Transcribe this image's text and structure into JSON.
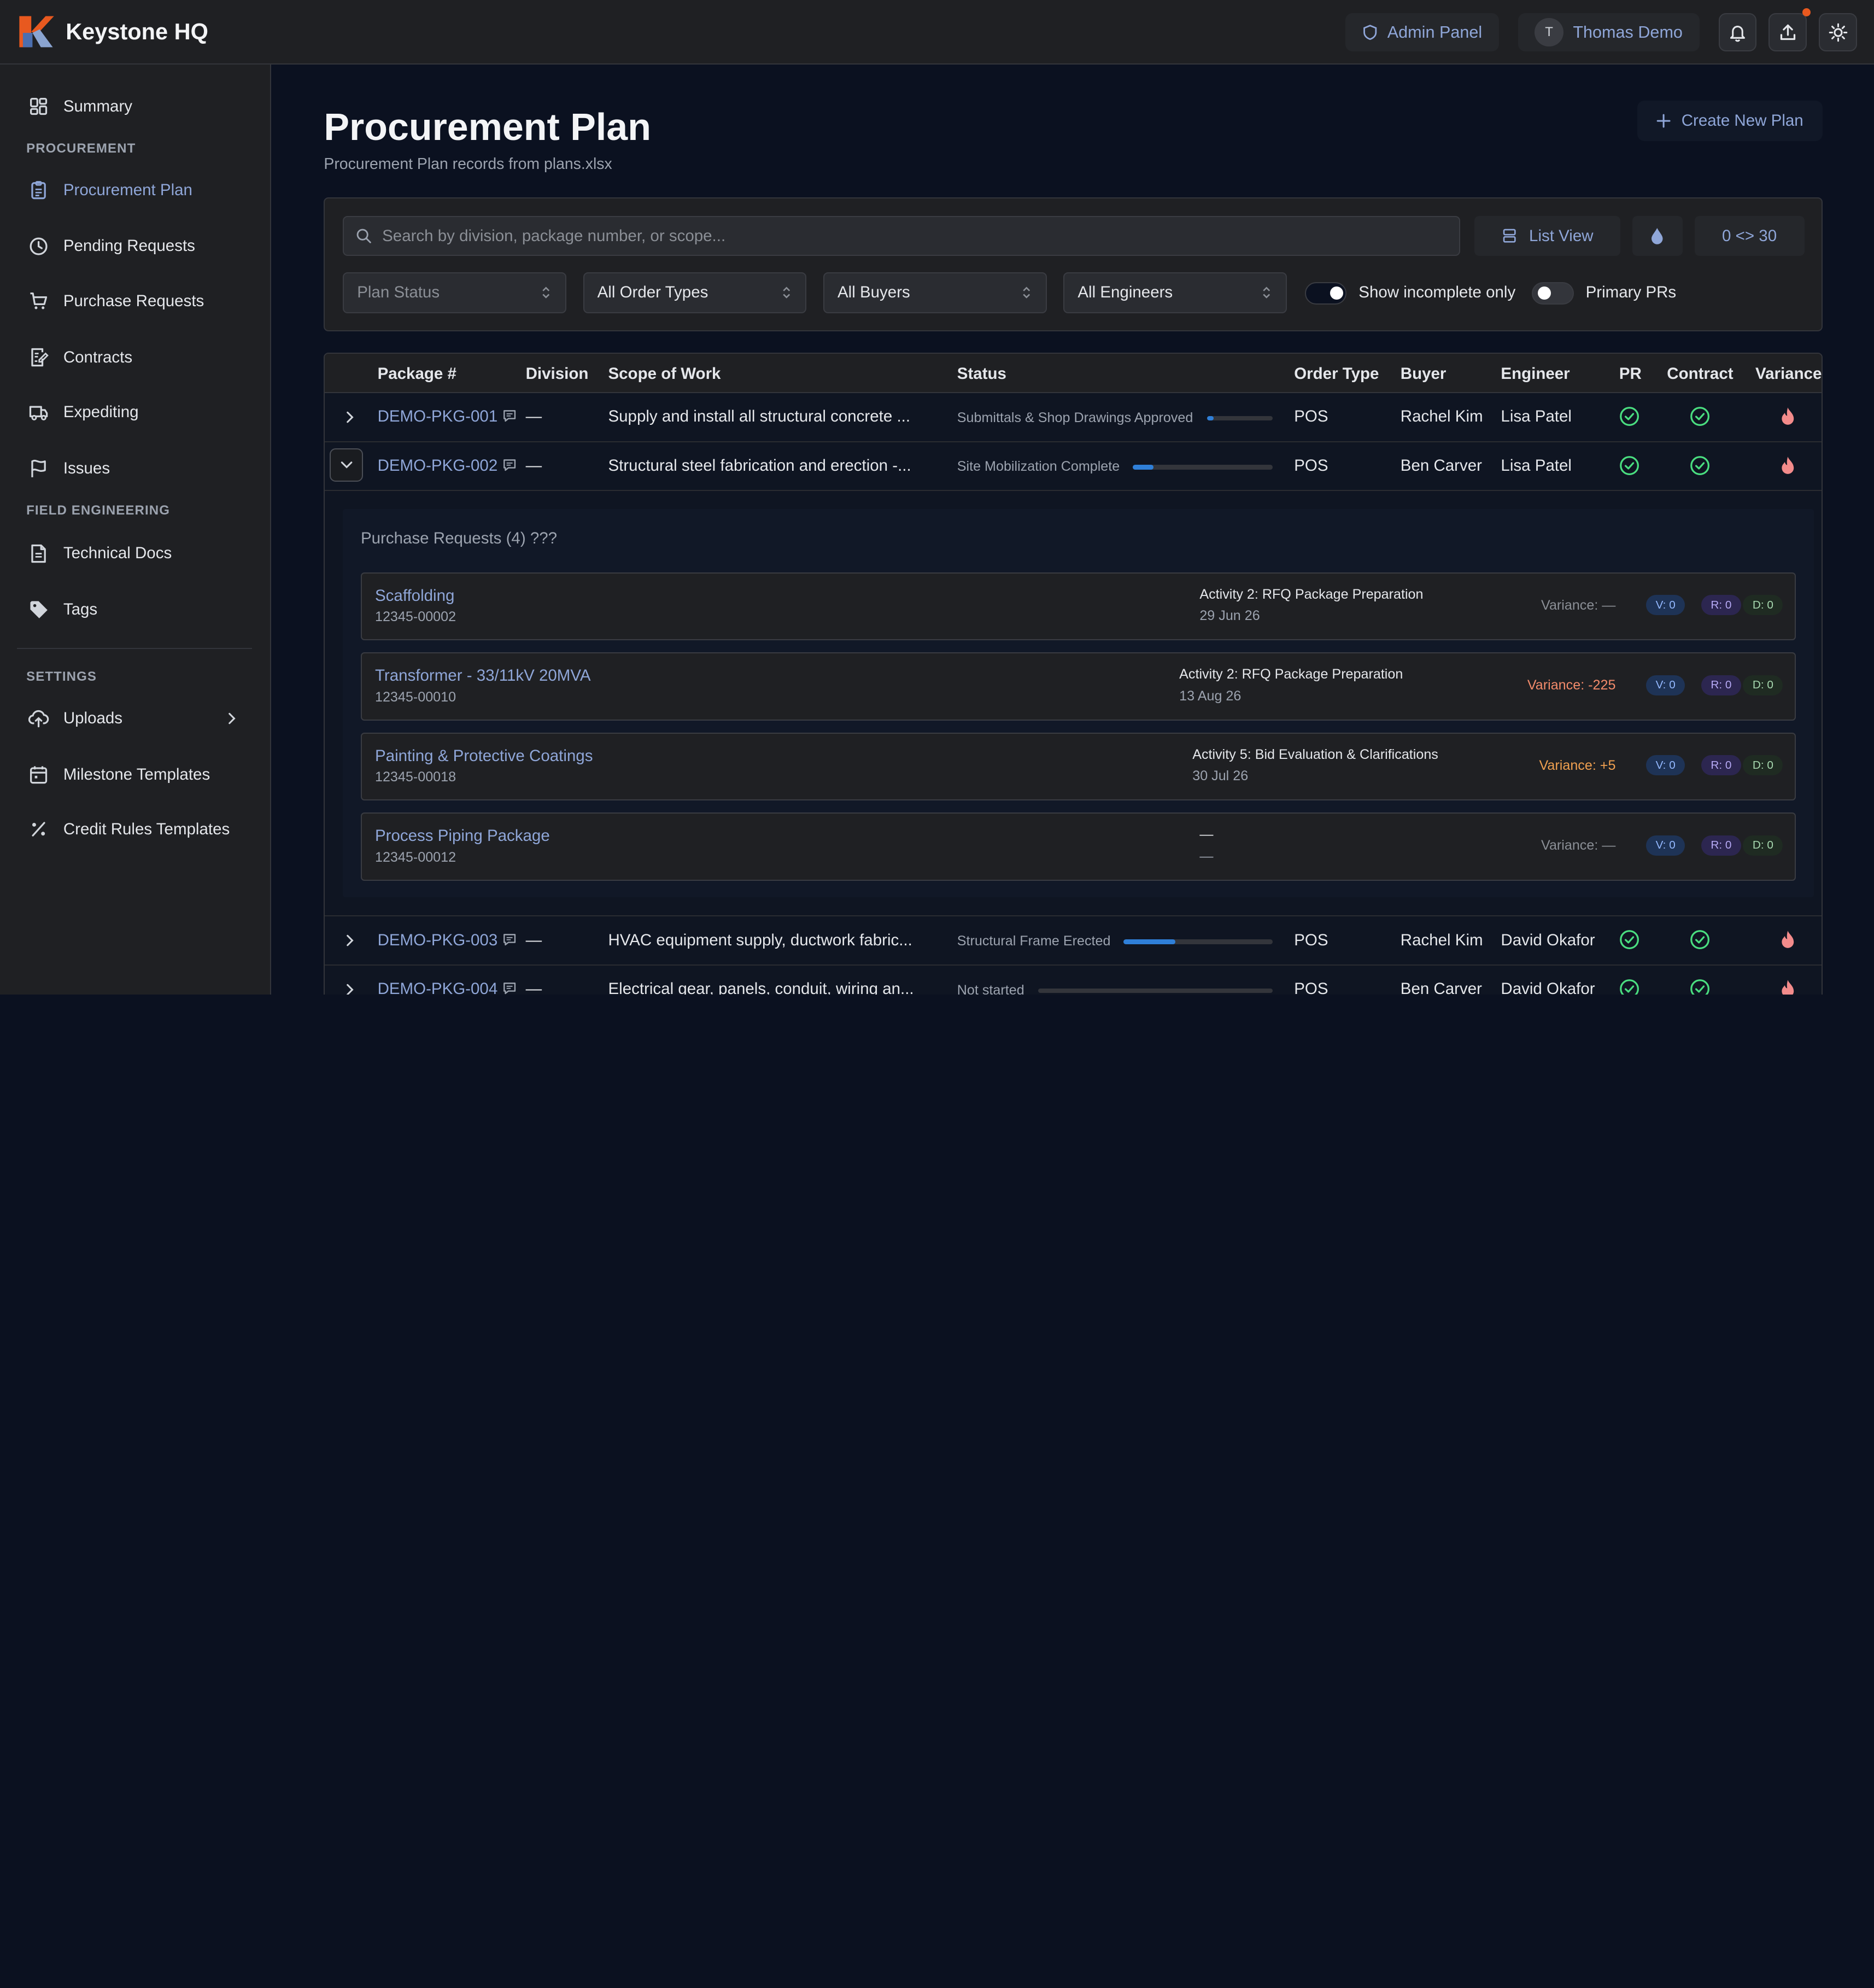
{
  "app": {
    "name": "Keystone HQ"
  },
  "topbar": {
    "admin_label": "Admin Panel",
    "user_initial": "T",
    "user_name": "Thomas Demo",
    "icons": [
      "bell-icon",
      "upload-icon",
      "sun-icon"
    ],
    "notification_color": "#e8591f"
  },
  "sidebar": {
    "summary": "Summary",
    "section_procurement": "PROCUREMENT",
    "procurement_plan": "Procurement Plan",
    "pending_requests": "Pending Requests",
    "purchase_requests": "Purchase Requests",
    "contracts": "Contracts",
    "expediting": "Expediting",
    "issues": "Issues",
    "section_field": "FIELD ENGINEERING",
    "technical_docs": "Technical Docs",
    "tags": "Tags",
    "section_settings": "SETTINGS",
    "uploads": "Uploads",
    "milestone_templates": "Milestone Templates",
    "credit_rules_templates": "Credit Rules Templates",
    "active_item": "Procurement Plan"
  },
  "page": {
    "title": "Procurement Plan",
    "subtitle": "Procurement Plan records from plans.xlsx",
    "create_label": "Create New Plan"
  },
  "filters": {
    "search_placeholder": "Search by division, package number, or scope...",
    "list_view_label": "List View",
    "range_label": "0 <> 30",
    "plan_status": "Plan Status",
    "order_types": "All Order Types",
    "buyers": "All Buyers",
    "engineers": "All Engineers",
    "show_incomplete_label": "Show incomplete only",
    "show_incomplete_on": true,
    "primary_prs_label": "Primary PRs",
    "primary_prs_on": false
  },
  "table": {
    "headers": {
      "package": "Package #",
      "division": "Division",
      "scope": "Scope of Work",
      "status": "Status",
      "order_type": "Order Type",
      "buyer": "Buyer",
      "engineer": "Engineer",
      "pr": "PR",
      "contract": "Contract",
      "variance": "Variance"
    },
    "rows": [
      {
        "package": "DEMO-PKG-001",
        "division": "—",
        "scope": "Supply and install all structural concrete ...",
        "status": "Submittals & Shop Drawings Approved",
        "progress": 0.1,
        "order_type": "POS",
        "buyer": "Rachel Kim",
        "engineer": "Lisa Patel",
        "expanded": false
      },
      {
        "package": "DEMO-PKG-002",
        "division": "—",
        "scope": "Structural steel fabrication and erection -...",
        "status": "Site Mobilization Complete",
        "progress": 0.15,
        "order_type": "POS",
        "buyer": "Ben Carver",
        "engineer": "Lisa Patel",
        "expanded": true
      },
      {
        "package": "DEMO-PKG-003",
        "division": "—",
        "scope": "HVAC equipment supply, ductwork fabric...",
        "status": "Structural Frame Erected",
        "progress": 0.35,
        "order_type": "POS",
        "buyer": "Rachel Kim",
        "engineer": "David Okafor",
        "expanded": false
      },
      {
        "package": "DEMO-PKG-004",
        "division": "—",
        "scope": "Electrical gear, panels, conduit, wiring an...",
        "status": "Not started",
        "progress": 0,
        "order_type": "POS",
        "buyer": "Ben Carver",
        "engineer": "David Okafor",
        "expanded": false
      }
    ]
  },
  "purchase_requests": {
    "title": "Purchase Requests (4) ???",
    "items": [
      {
        "name": "Scaffolding",
        "number": "12345-00002",
        "activity": "Activity 2: RFQ Package Preparation",
        "date": "29 Jun 26",
        "variance": "Variance: —",
        "v": "V: 0",
        "r": "R: 0",
        "d": "D: 0"
      },
      {
        "name": "Transformer - 33/11kV 20MVA",
        "number": "12345-00010",
        "activity": "Activity 2: RFQ Package Preparation",
        "date": "13 Aug 26",
        "variance": "Variance: -225",
        "v": "V: 0",
        "r": "R: 0",
        "d": "D: 0"
      },
      {
        "name": "Painting & Protective Coatings",
        "number": "12345-00018",
        "activity": "Activity 5: Bid Evaluation & Clarifications",
        "date": "30 Jul 26",
        "variance": "Variance: +5",
        "v": "V: 0",
        "r": "R: 0",
        "d": "D: 0"
      },
      {
        "name": "Process Piping Package",
        "number": "12345-00012",
        "activity": "—",
        "date": "—",
        "variance": "Variance: —",
        "v": "V: 0",
        "r": "R: 0",
        "d": "D: 0"
      }
    ]
  }
}
